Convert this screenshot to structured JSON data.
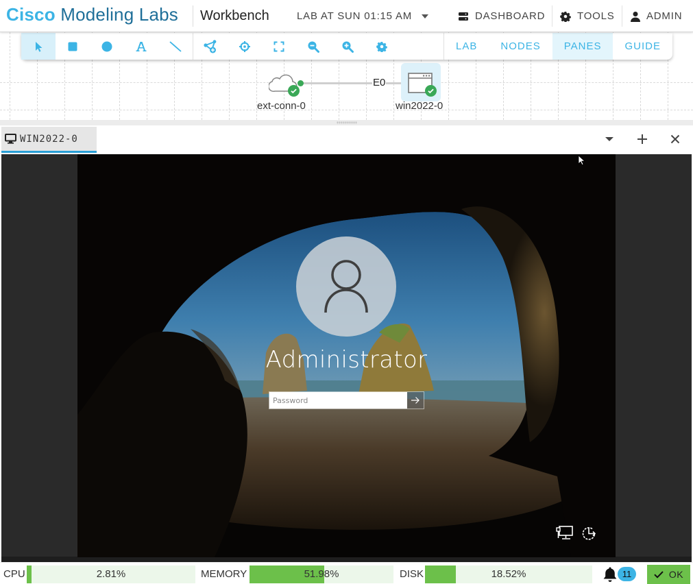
{
  "header": {
    "brand_primary": "Cisco",
    "brand_secondary": "Modeling Labs",
    "section": "Workbench",
    "lab_selector": "LAB AT SUN 01:15 AM",
    "nav": [
      {
        "label": "DASHBOARD",
        "icon": "server-icon"
      },
      {
        "label": "TOOLS",
        "icon": "gear-icon"
      },
      {
        "label": "ADMIN",
        "icon": "user-icon"
      }
    ]
  },
  "toolbar": {
    "tools": [
      {
        "name": "select",
        "icon": "pointer-icon",
        "active": true
      },
      {
        "name": "rectangle",
        "icon": "square-icon"
      },
      {
        "name": "ellipse",
        "icon": "circle-icon"
      },
      {
        "name": "text",
        "icon": "text-icon"
      },
      {
        "name": "line",
        "icon": "line-icon"
      },
      {
        "name": "add-node",
        "icon": "add-node-icon"
      },
      {
        "name": "center",
        "icon": "crosshair-icon"
      },
      {
        "name": "fit",
        "icon": "fit-screen-icon"
      },
      {
        "name": "zoom-out",
        "icon": "zoom-out-icon"
      },
      {
        "name": "zoom-in",
        "icon": "zoom-in-icon"
      },
      {
        "name": "settings",
        "icon": "gear-icon"
      }
    ],
    "tabs": [
      {
        "label": "LAB",
        "active": false
      },
      {
        "label": "NODES",
        "active": false
      },
      {
        "label": "PANES",
        "active": true
      },
      {
        "label": "GUIDE",
        "active": false
      }
    ],
    "accent": "#3cb4e5"
  },
  "topology": {
    "nodes": [
      {
        "label": "ext-conn-0",
        "icon": "cloud-icon",
        "status": "booted"
      },
      {
        "label": "win2022-0",
        "icon": "server-window-icon",
        "status": "booted",
        "selected": true
      }
    ],
    "links": [
      {
        "label": "E0"
      }
    ]
  },
  "pane": {
    "tab_label": "WIN2022-0",
    "tab_icon": "monitor-icon",
    "controls": [
      "dropdown",
      "add",
      "close"
    ]
  },
  "console": {
    "username": "Administrator",
    "password_placeholder": "Password",
    "bottom_icons": [
      "network-icon",
      "power-icon"
    ]
  },
  "status": {
    "cpu": {
      "label": "CPU",
      "value": "2.81%",
      "fraction": 0.0281
    },
    "memory": {
      "label": "MEMORY",
      "value": "51.98%",
      "fraction": 0.5198
    },
    "disk": {
      "label": "DISK",
      "value": "18.52%",
      "fraction": 0.1852
    },
    "notifications": "11",
    "ok_label": "OK",
    "ok_color": "#6cc04a"
  }
}
